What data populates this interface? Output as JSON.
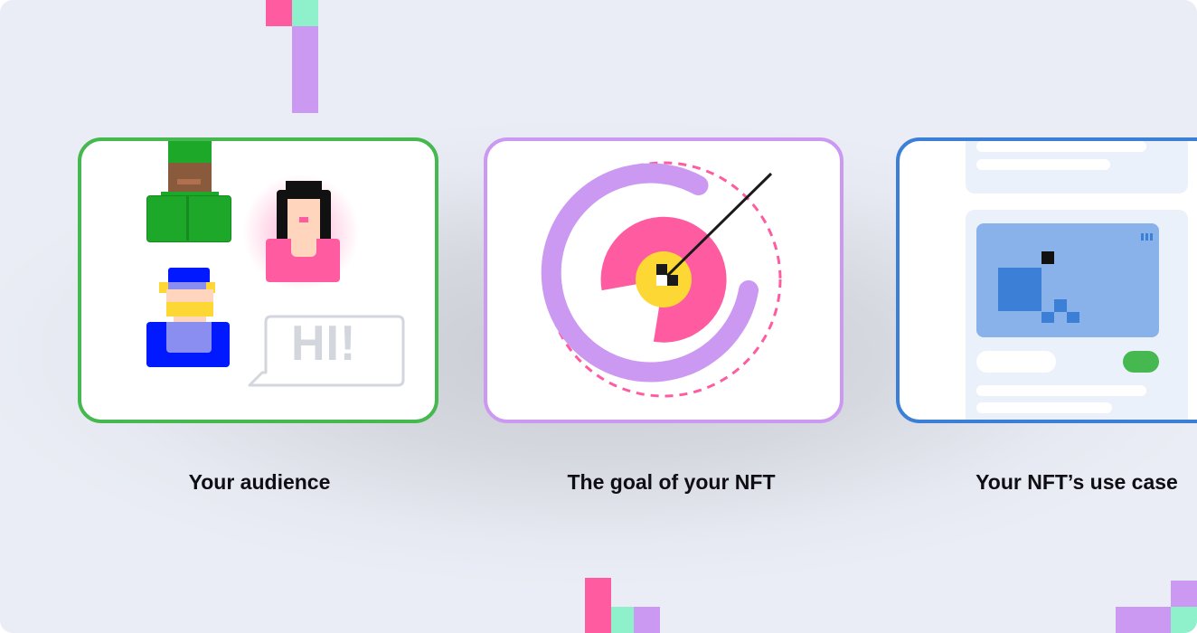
{
  "cards": [
    {
      "id": "audience",
      "caption": "Your audience",
      "border_color": "#45b84f",
      "bubble_text": "HI!"
    },
    {
      "id": "goal",
      "caption": "The goal of your NFT",
      "border_color": "#cc99f2"
    },
    {
      "id": "use-case",
      "caption": "Your NFT’s use case",
      "border_color": "#3c7fd6"
    }
  ],
  "colors": {
    "pink": "#ff5ba1",
    "mint": "#8ff0cc",
    "lavender": "#cc99f2",
    "green": "#1ea82a",
    "blue": "#0019ff",
    "yellow": "#fdd835",
    "switch_green": "#45b84f"
  }
}
